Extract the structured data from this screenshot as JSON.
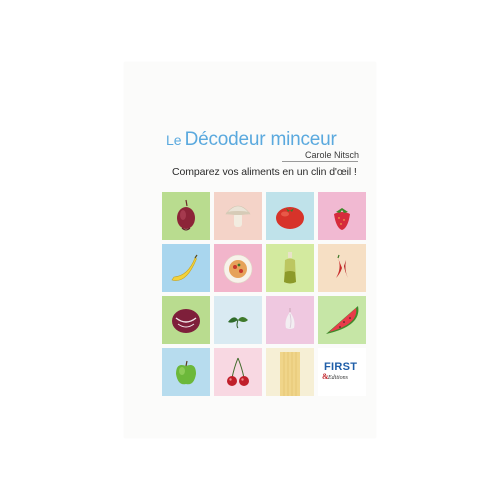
{
  "cover": {
    "title_prefix": "Le",
    "title_main": "Décodeur minceur",
    "author": "Carole Nitsch",
    "subtitle": "Comparez vos aliments en un clin d'œil !",
    "publisher": {
      "name": "FIRST",
      "ampersand": "&",
      "suffix": "Editions"
    },
    "colors": {
      "title": "#5aa9de",
      "publisher": "#1f5ea8"
    },
    "tiles": [
      {
        "name": "onion",
        "icon": "onion-icon",
        "bg": "#b9dc8f"
      },
      {
        "name": "mushroom",
        "icon": "mushroom-icon",
        "bg": "#f4d3c8"
      },
      {
        "name": "tomato",
        "icon": "tomato-icon",
        "bg": "#bfe2ea"
      },
      {
        "name": "strawberry",
        "icon": "strawberry-icon",
        "bg": "#f1b9d2"
      },
      {
        "name": "banana",
        "icon": "banana-icon",
        "bg": "#a9d6ee"
      },
      {
        "name": "pasta-plate",
        "icon": "pasta-plate-icon",
        "bg": "#f2b5cb"
      },
      {
        "name": "oil-bottle",
        "icon": "oil-bottle-icon",
        "bg": "#d3ea9f"
      },
      {
        "name": "chili-pepper",
        "icon": "chili-pepper-icon",
        "bg": "#f6dfc4"
      },
      {
        "name": "radicchio",
        "icon": "radicchio-icon",
        "bg": "#b9dc8f"
      },
      {
        "name": "basil",
        "icon": "basil-icon",
        "bg": "#d9eaf2"
      },
      {
        "name": "garlic",
        "icon": "garlic-icon",
        "bg": "#efc8e0"
      },
      {
        "name": "watermelon",
        "icon": "watermelon-icon",
        "bg": "#c6e6a6"
      },
      {
        "name": "apple",
        "icon": "apple-icon",
        "bg": "#b7dcee"
      },
      {
        "name": "cherries",
        "icon": "cherries-icon",
        "bg": "#f8d8e2"
      },
      {
        "name": "spaghetti",
        "icon": "spaghetti-icon",
        "bg": "#f6efd5"
      },
      {
        "name": "publisher-logo",
        "icon": "first-logo-icon",
        "bg": "#ffffff"
      }
    ]
  }
}
